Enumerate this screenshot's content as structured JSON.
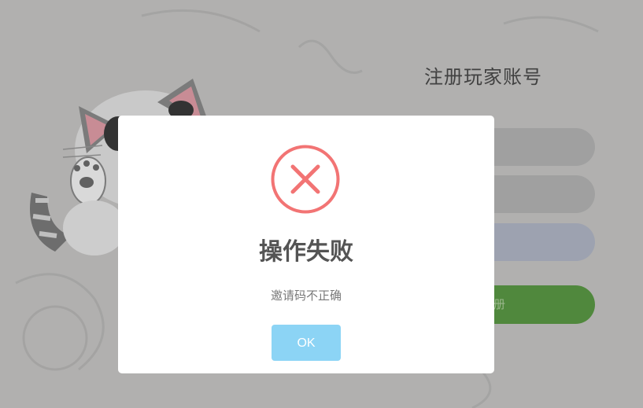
{
  "register_form": {
    "title": "注册玩家账号",
    "submit_label": "册"
  },
  "dialog": {
    "icon": "error-x-icon",
    "title": "操作失败",
    "message": "邀请码不正确",
    "ok_label": "OK"
  },
  "colors": {
    "error_red": "#f27474",
    "ok_button": "#8cd4f5",
    "submit_green": "#4b8a35"
  }
}
